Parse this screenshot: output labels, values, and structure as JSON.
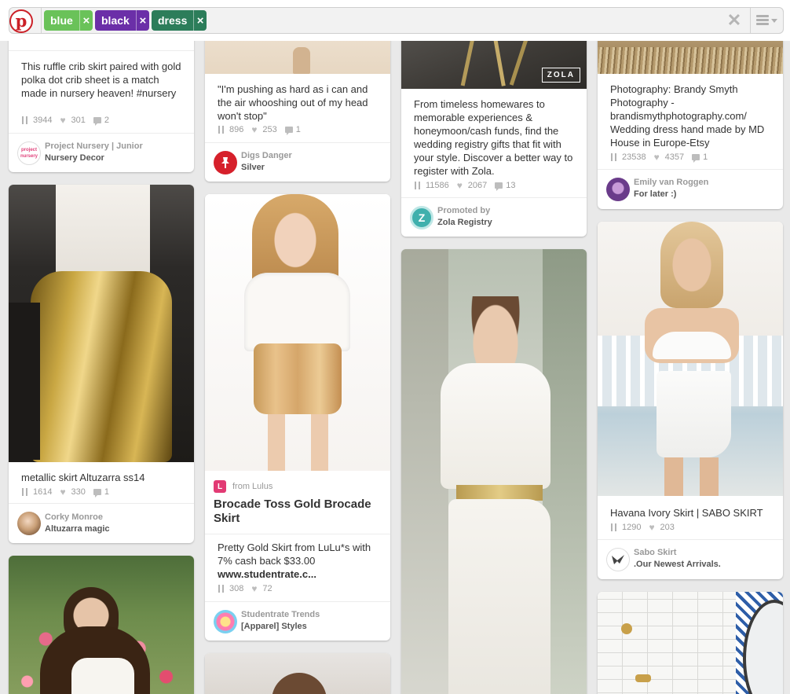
{
  "search": {
    "tokens": [
      {
        "label": "blue",
        "color": "#6ac259"
      },
      {
        "label": "black",
        "color": "#6b2fa8"
      },
      {
        "label": "dress",
        "color": "#2c7d5a"
      }
    ],
    "remove_glyph": "×",
    "clear_glyph": "✕"
  },
  "logo": {
    "glyph": "p",
    "color": "#cb2027"
  },
  "pins": {
    "nursery": {
      "description": "This ruffle crib skirt paired with gold polka dot crib sheet is a match made in nursery heaven! #nursery",
      "repins": "3944",
      "likes": "301",
      "comments": "2",
      "owner": "Project Nursery | Junior",
      "board": "Nursery Decor",
      "avatar_text": "project nursery"
    },
    "altuzarra": {
      "description": "metallic skirt Altuzarra ss14",
      "repins": "1614",
      "likes": "330",
      "comments": "1",
      "owner": "Corky Monroe",
      "board": "Altuzarra magic"
    },
    "digs": {
      "description": "\"I'm pushing as hard as i can and the air whooshing out of my head won't stop\"",
      "repins": "896",
      "likes": "253",
      "comments": "1",
      "owner": "Digs Danger",
      "board": "Silver"
    },
    "lulus": {
      "from": "from Lulus",
      "title": "Brocade Toss Gold Brocade Skirt",
      "description": "Pretty Gold Skirt from LuLu*s with 7% cash back $33.00",
      "link": "www.studentrate.c...",
      "repins": "308",
      "likes": "72",
      "owner": "Studentrate Trends",
      "board": "[Apparel] Styles"
    },
    "zola": {
      "badge": "ZOLA",
      "description": "From timeless homewares to memorable experiences & honeymoon/cash funds, find the wedding registry gifts that fit with your style. Discover a better way to register with Zola.",
      "repins": "11586",
      "likes": "2067",
      "comments": "13",
      "owner": "Promoted by",
      "board": "Zola Registry",
      "avatar_text": "Z"
    },
    "brandy": {
      "description": "Photography: Brandy Smyth Photography - brandismythphotography.com/ Wedding dress hand made by MD House in Europe-Etsy",
      "repins": "23538",
      "likes": "4357",
      "comments": "1",
      "owner": "Emily van Roggen",
      "board": "For later :)"
    },
    "sabo": {
      "description": "Havana Ivory Skirt | SABO SKIRT",
      "repins": "1290",
      "likes": "203",
      "owner": "Sabo Skirt",
      "board": ".Our Newest Arrivals."
    }
  }
}
